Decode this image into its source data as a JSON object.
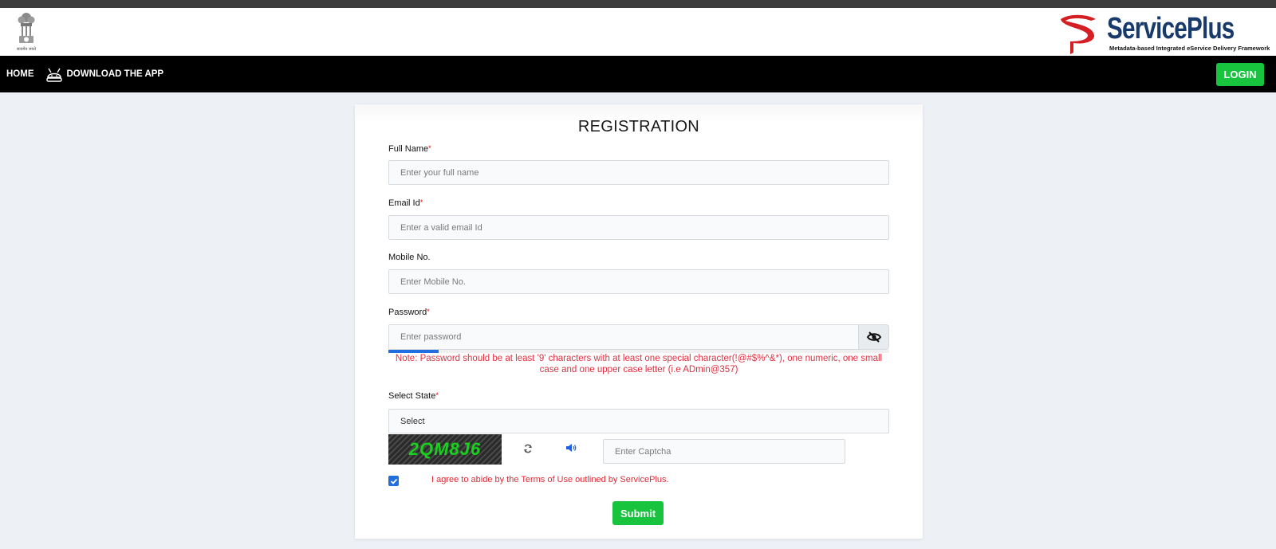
{
  "header": {
    "emblem_caption": "सत्यमेव जयते",
    "brand_name": "ServicePlus",
    "brand_tagline": "Metadata-based Integrated eService Delivery Framework"
  },
  "nav": {
    "home": "HOME",
    "download_app": "DOWNLOAD THE APP",
    "login": "LOGIN"
  },
  "form": {
    "title": "REGISTRATION",
    "full_name": {
      "label": "Full Name",
      "required": "*",
      "placeholder": "Enter your full name",
      "value": ""
    },
    "email": {
      "label": "Email Id",
      "required": "*",
      "placeholder": "Enter a valid email Id",
      "value": ""
    },
    "mobile": {
      "label": "Mobile No.",
      "placeholder": "Enter Mobile No.",
      "value": ""
    },
    "password": {
      "label": "Password",
      "required": "*",
      "placeholder": "Enter password",
      "value": "",
      "toggle_icon": "eye-slash-icon",
      "strength_percent": 10,
      "note": "Note: Password should be at least '9' characters with at least one special character(!@#$%^&*), one numeric, one small case and one upper case letter (i.e ADmin@357)"
    },
    "state": {
      "label": "Select State",
      "required": "*",
      "selected": "Select"
    },
    "captcha": {
      "image_text": "2QM8J6",
      "refresh_icon": "refresh-icon",
      "audio_icon": "volume-icon",
      "placeholder": "Enter Captcha",
      "value": ""
    },
    "agree": {
      "checked": true,
      "text": "I agree to abide by the Terms of Use outlined by ServicePlus."
    },
    "submit": "Submit"
  },
  "colors": {
    "accent_green": "#18c43e",
    "error_red": "#e03040",
    "brand_blue": "#183a6b",
    "checkbox_blue": "#1f6fe0"
  }
}
